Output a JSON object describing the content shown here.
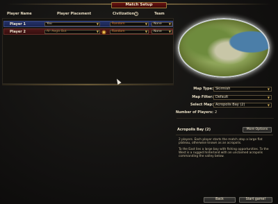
{
  "window": {
    "title": "Match Setup"
  },
  "table": {
    "headers": {
      "name": "Player Name",
      "placement": "Player Placement",
      "civilization": "Civilization",
      "team": "Team"
    },
    "players": [
      {
        "name": "Player 1",
        "placement": "You",
        "civilization": "Random",
        "team": "None",
        "color": "#243269"
      },
      {
        "name": "Player 2",
        "placement": "AI: Aegis Bot",
        "civilization": "Random",
        "team": "None",
        "color": "#4d1616"
      }
    ]
  },
  "map": {
    "type_label": "Map Type:",
    "type_value": "Skirmish",
    "filter_label": "Map Filter:",
    "filter_value": "Default",
    "select_label": "Select Map:",
    "select_value": "Acropolis Bay (2)",
    "players_label": "Number of Players:",
    "players_value": "2"
  },
  "description": {
    "title": "Acropolis Bay (2)",
    "more_label": "More Options",
    "para1": "2 players. Each player starts the match atop a large flat plateau, otherwise known as an acropolis.",
    "para2": "To the East lies a large bay with fishing opportunities. To the West is a rugged hinterland with an unclaimed acropolis commanding the valley below."
  },
  "buttons": {
    "back": "Back",
    "start": "Start game!"
  },
  "icons": {
    "info": "i",
    "dropdown": "▼"
  }
}
